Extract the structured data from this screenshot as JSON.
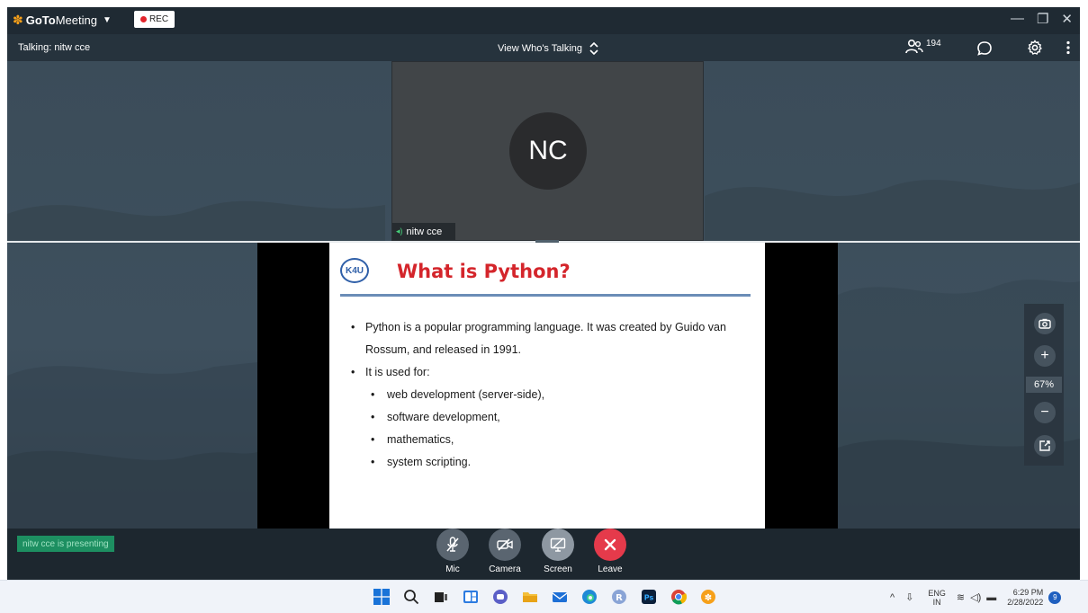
{
  "app": {
    "brand_bold": "GoTo",
    "brand_rest": "Meeting",
    "rec_label": "REC"
  },
  "infobar": {
    "talking": "Talking: nitw cce",
    "view_mode": "View Who's Talking",
    "participant_count": "194"
  },
  "video": {
    "initials": "NC",
    "name": "nitw cce",
    "avatar_color": "#2a2b2d"
  },
  "slide": {
    "logo": "K4U",
    "title": "What is Python?",
    "bullets": [
      "Python is a popular programming language. It was created by Guido van Rossum, and released in 1991.",
      "It is used for:"
    ],
    "sub_bullets": [
      "web development (server-side),",
      "software development,",
      "mathematics,",
      "system scripting."
    ],
    "title_color": "#d4252b"
  },
  "zoom": {
    "level": "67%"
  },
  "bottom": {
    "presenting": "nitw cce is presenting",
    "controls": {
      "mic": "Mic",
      "camera": "Camera",
      "screen": "Screen",
      "leave": "Leave"
    },
    "leave_color": "#e53a4b",
    "presenting_color": "#1d8f61"
  },
  "taskbar": {
    "lang_top": "ENG",
    "lang_bottom": "IN",
    "time": "6:29 PM",
    "date": "2/28/2022",
    "notifications": "9",
    "apps": [
      "windows-start",
      "search",
      "task-view",
      "widgets",
      "chat",
      "file-explorer",
      "mail",
      "edge",
      "r-app",
      "photoshop",
      "chrome",
      "gotomeeting"
    ]
  }
}
